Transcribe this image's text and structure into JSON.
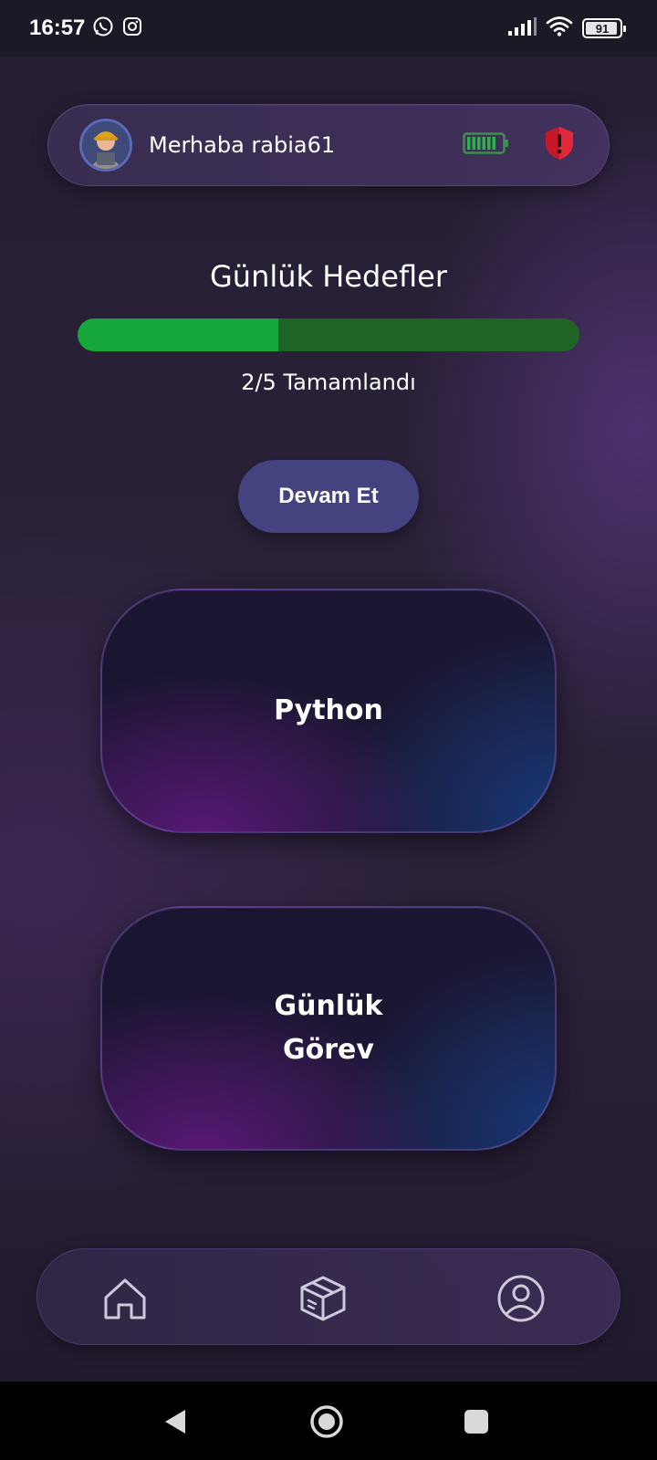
{
  "status_bar": {
    "time": "16:57",
    "battery_level": "91",
    "icons": [
      "whatsapp-icon",
      "instagram-icon",
      "signal-icon",
      "wifi-icon",
      "battery-icon"
    ]
  },
  "header": {
    "greeting": "Merhaba rabia61",
    "avatar_icon": "user-avatar",
    "energy_icon": "green-battery-icon",
    "alert_icon": "red-shield-alert-icon"
  },
  "goals": {
    "title": "Günlük Hedefler",
    "completed": 2,
    "total": 5,
    "progress_fraction": 0.4,
    "progress_text": "2/5 Tamamlandı",
    "colors": {
      "fill": "#16a83a",
      "track": "#1f6425"
    }
  },
  "continue_button": {
    "label": "Devam Et",
    "color": "#44427f"
  },
  "cards": [
    {
      "label": "Python"
    },
    {
      "label": "Günlük Görev"
    }
  ],
  "bottom_nav": {
    "items": [
      {
        "icon": "home-icon"
      },
      {
        "icon": "box-icon"
      },
      {
        "icon": "profile-icon"
      }
    ]
  },
  "system_nav": [
    "back-icon",
    "home-circle-icon",
    "recents-icon"
  ]
}
